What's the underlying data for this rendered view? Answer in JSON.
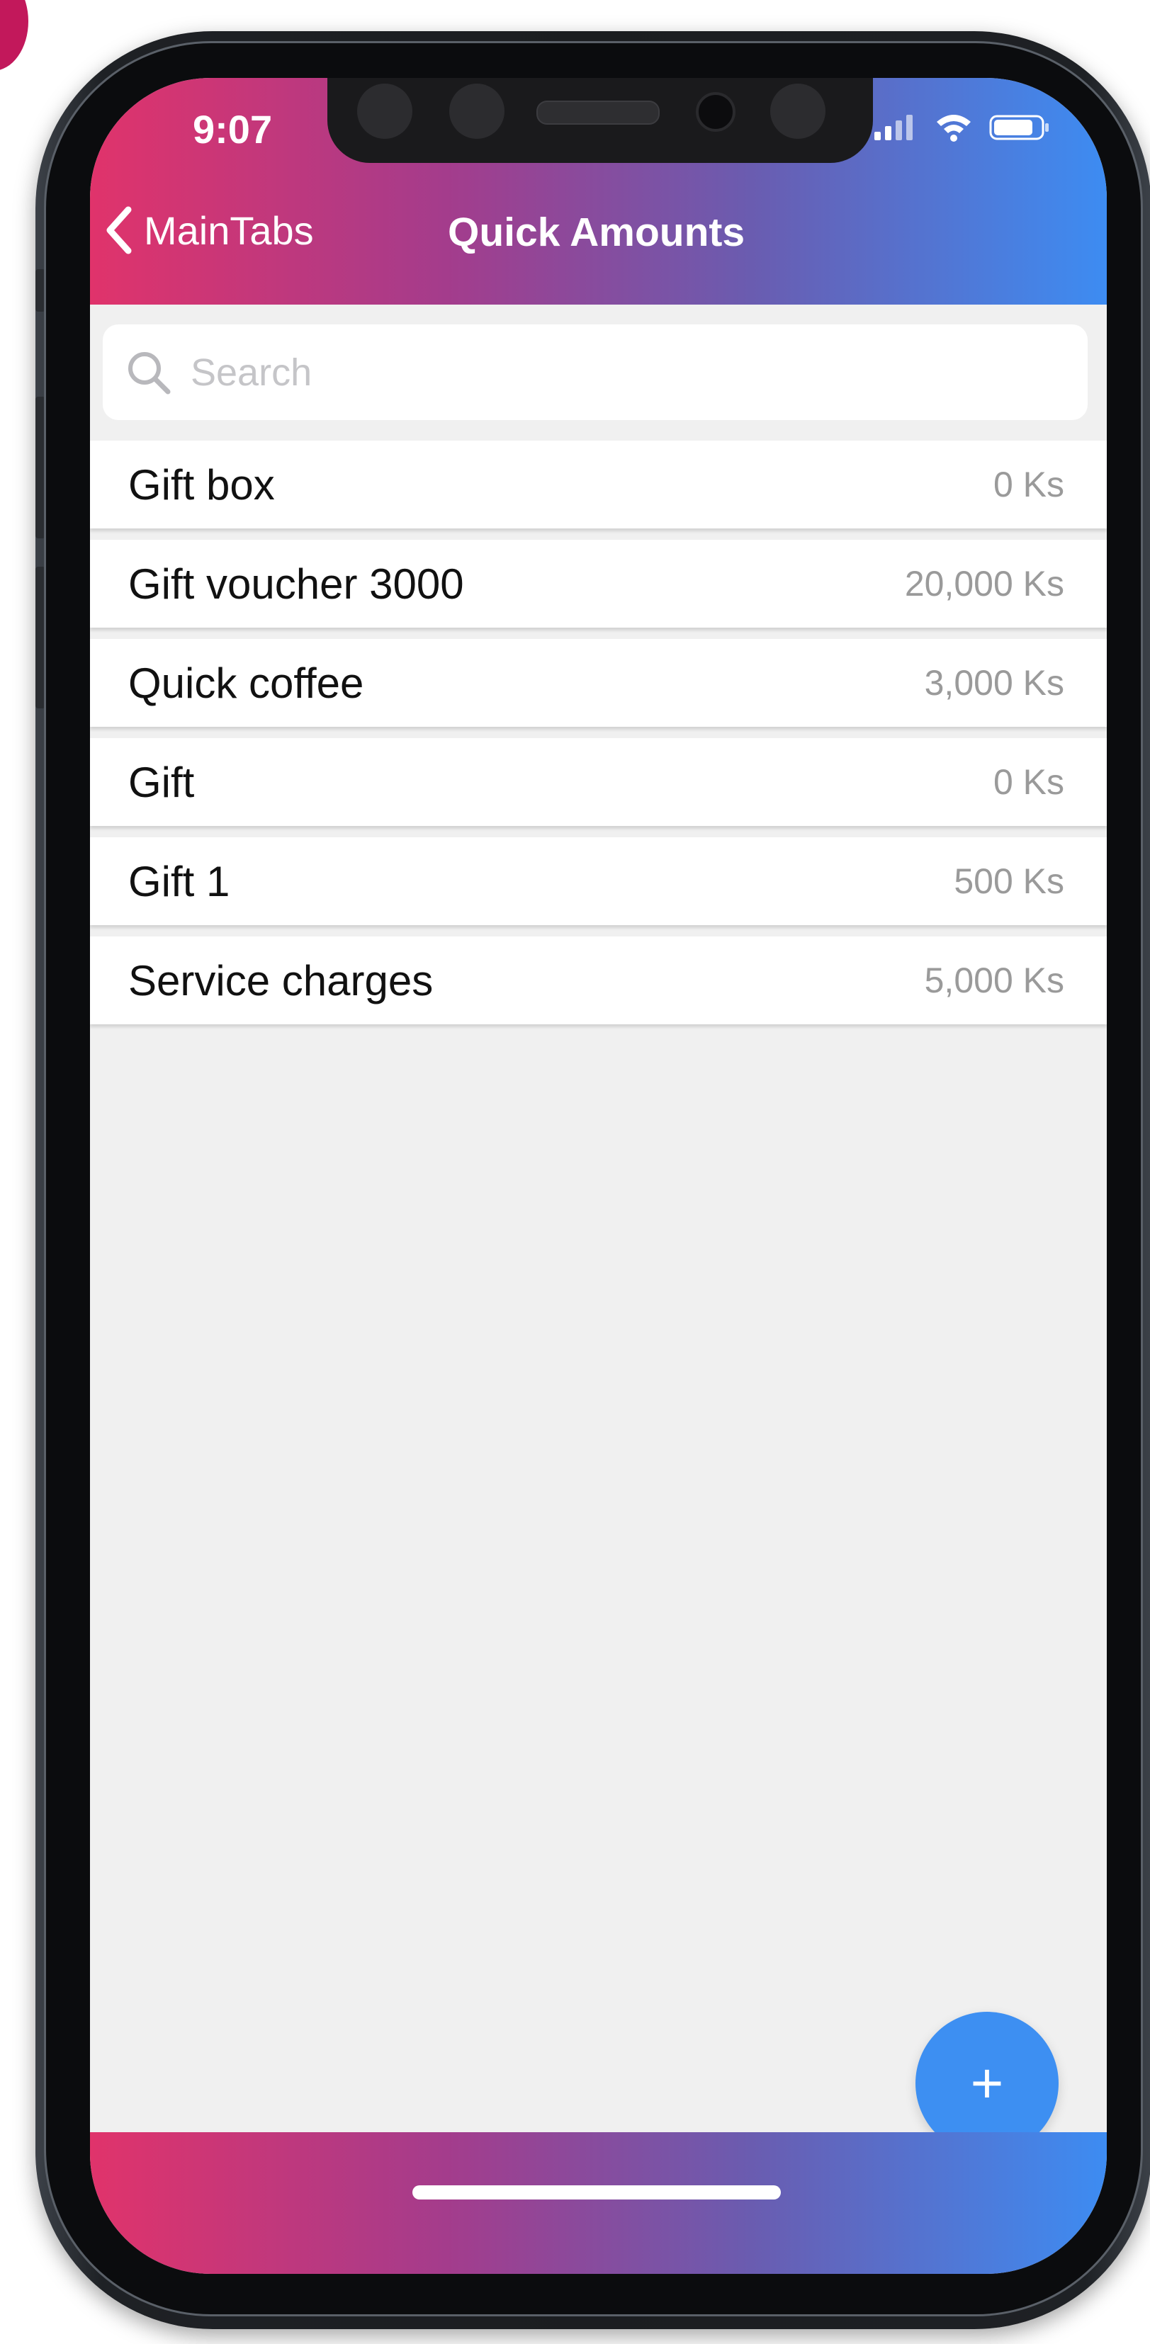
{
  "status_bar": {
    "time": "9:07"
  },
  "nav": {
    "back_label": "MainTabs",
    "title": "Quick Amounts"
  },
  "search": {
    "placeholder": "Search",
    "value": ""
  },
  "items": [
    {
      "name": "Gift box",
      "amount": "0 Ks"
    },
    {
      "name": "Gift voucher 3000",
      "amount": "20,000 Ks"
    },
    {
      "name": "Quick coffee",
      "amount": "3,000 Ks"
    },
    {
      "name": "Gift",
      "amount": "0 Ks"
    },
    {
      "name": "Gift 1",
      "amount": "500 Ks"
    },
    {
      "name": "Service charges",
      "amount": "5,000 Ks"
    }
  ],
  "fab": {
    "label": "+"
  },
  "colors": {
    "gradient_start": "#e0336b",
    "gradient_end": "#3d8cf2",
    "fab": "#3d8ff2",
    "background": "#f0f0f0"
  },
  "icons": [
    "back-chevron-icon",
    "search-icon",
    "signal-icon",
    "wifi-icon",
    "battery-icon",
    "plus-icon"
  ]
}
